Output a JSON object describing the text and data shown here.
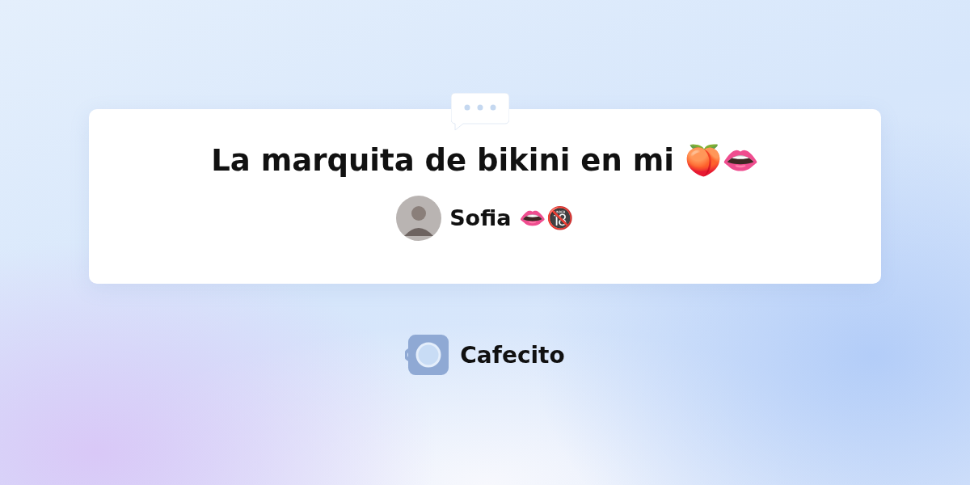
{
  "post": {
    "title": "La marquita de bikini en mi 🍑👄",
    "author": {
      "name": "Sofia 👄🔞"
    }
  },
  "brand": {
    "name": "Cafecito"
  }
}
